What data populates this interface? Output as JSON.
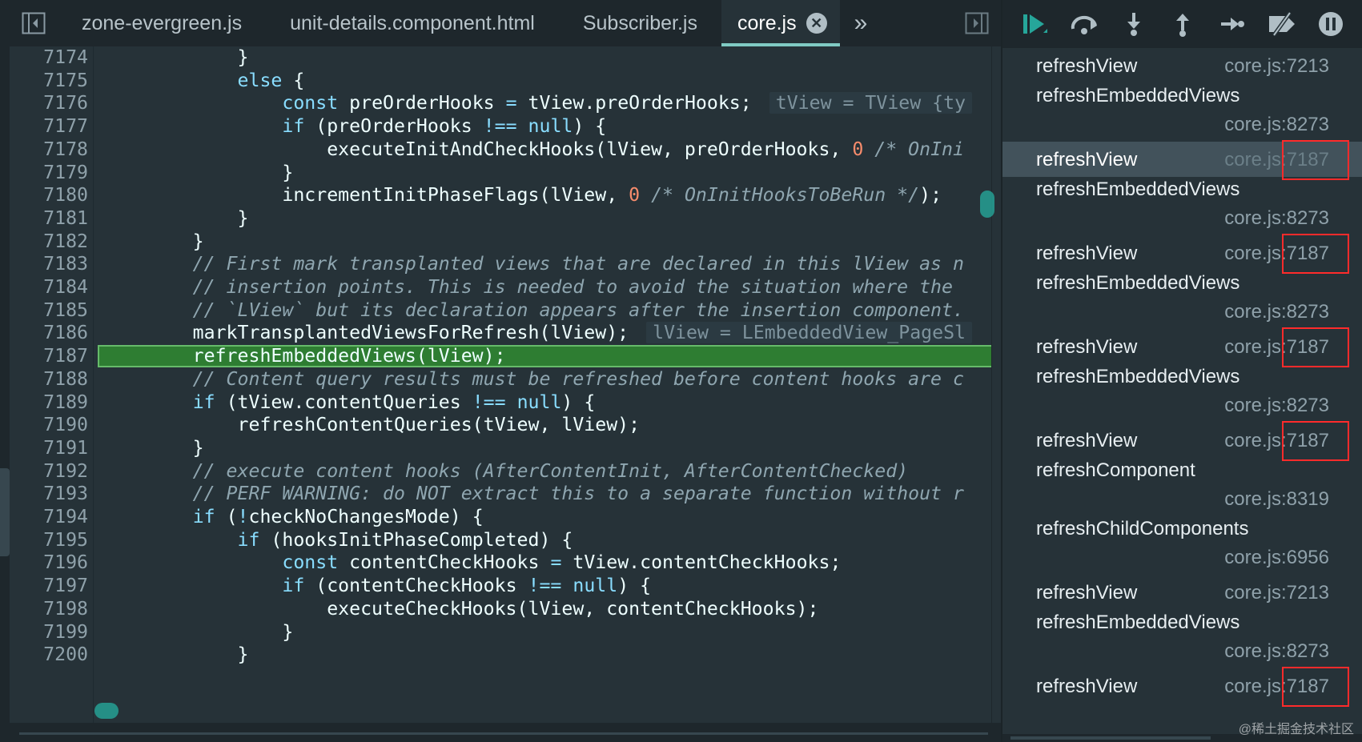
{
  "tabs": [
    {
      "label": "zone-evergreen.js"
    },
    {
      "label": "unit-details.component.html"
    },
    {
      "label": "Subscriber.js"
    },
    {
      "label": "core.js",
      "active": true
    }
  ],
  "tab_close_symbol": "✕",
  "tab_overflow_symbol": "»",
  "icons": {
    "sidebar_toggle": "sidebar-toggle-icon",
    "panel_toggle": "panel-toggle-icon",
    "resume": "resume-icon",
    "step_over": "step-over-icon",
    "step_into": "step-into-icon",
    "step_out": "step-out-icon",
    "step": "step-icon",
    "deactivate_breakpoints": "deactivate-breakpoints-icon",
    "pause_on_exceptions": "pause-icon"
  },
  "colors": {
    "keyword": "#89ddff",
    "comment": "#8fa6b0",
    "number": "#f78c6c",
    "current_line": "#2e7d32",
    "accent": "#80cbc4",
    "annotation_box": "#ff2b2b"
  },
  "code": {
    "current_line": 7187,
    "lines": [
      {
        "n": "7174",
        "t": "            }"
      },
      {
        "n": "7175",
        "t": "            else {"
      },
      {
        "n": "7176",
        "t": "                const preOrderHooks = tView.preOrderHooks;",
        "inline": "tView = TView {ty"
      },
      {
        "n": "7177",
        "t": "                if (preOrderHooks !== null) {"
      },
      {
        "n": "7178",
        "t": "                    executeInitAndCheckHooks(lView, preOrderHooks, 0 /* OnIni"
      },
      {
        "n": "7179",
        "t": "                }"
      },
      {
        "n": "7180",
        "t": "                incrementInitPhaseFlags(lView, 0 /* OnInitHooksToBeRun */);"
      },
      {
        "n": "7181",
        "t": "            }"
      },
      {
        "n": "7182",
        "t": "        }"
      },
      {
        "n": "7183",
        "t": "        // First mark transplanted views that are declared in this lView as n"
      },
      {
        "n": "7184",
        "t": "        // insertion points. This is needed to avoid the situation where the"
      },
      {
        "n": "7185",
        "t": "        // `LView` but its declaration appears after the insertion component."
      },
      {
        "n": "7186",
        "t": "        markTransplantedViewsForRefresh(lView);",
        "inline": "lView = LEmbeddedView_PageSl"
      },
      {
        "n": "7187",
        "t": "        refreshEmbeddedViews(lView);"
      },
      {
        "n": "7188",
        "t": "        // Content query results must be refreshed before content hooks are c"
      },
      {
        "n": "7189",
        "t": "        if (tView.contentQueries !== null) {"
      },
      {
        "n": "7190",
        "t": "            refreshContentQueries(tView, lView);"
      },
      {
        "n": "7191",
        "t": "        }"
      },
      {
        "n": "7192",
        "t": "        // execute content hooks (AfterContentInit, AfterContentChecked)"
      },
      {
        "n": "7193",
        "t": "        // PERF WARNING: do NOT extract this to a separate function without r"
      },
      {
        "n": "7194",
        "t": "        if (!checkNoChangesMode) {"
      },
      {
        "n": "7195",
        "t": "            if (hooksInitPhaseCompleted) {"
      },
      {
        "n": "7196",
        "t": "                const contentCheckHooks = tView.contentCheckHooks;"
      },
      {
        "n": "7197",
        "t": "                if (contentCheckHooks !== null) {"
      },
      {
        "n": "7198",
        "t": "                    executeCheckHooks(lView, contentCheckHooks);"
      },
      {
        "n": "7199",
        "t": "                }"
      },
      {
        "n": "7200",
        "t": "            }"
      }
    ]
  },
  "call_stack": [
    {
      "fn": "refreshView",
      "loc": "core.js:7213",
      "layout": "inline",
      "highlight": false
    },
    {
      "fn": "refreshEmbeddedViews",
      "loc": "core.js:8273",
      "layout": "stacked",
      "highlight": false
    },
    {
      "fn": "refreshView",
      "loc": "core.js:7187",
      "layout": "inline",
      "highlight": true,
      "selected": true
    },
    {
      "fn": "refreshEmbeddedViews",
      "loc": "core.js:8273",
      "layout": "stacked",
      "highlight": false
    },
    {
      "fn": "refreshView",
      "loc": "core.js:7187",
      "layout": "inline",
      "highlight": true
    },
    {
      "fn": "refreshEmbeddedViews",
      "loc": "core.js:8273",
      "layout": "stacked",
      "highlight": false
    },
    {
      "fn": "refreshView",
      "loc": "core.js:7187",
      "layout": "inline",
      "highlight": true
    },
    {
      "fn": "refreshEmbeddedViews",
      "loc": "core.js:8273",
      "layout": "stacked",
      "highlight": false
    },
    {
      "fn": "refreshView",
      "loc": "core.js:7187",
      "layout": "inline",
      "highlight": true
    },
    {
      "fn": "refreshComponent",
      "loc": "core.js:8319",
      "layout": "stacked",
      "highlight": false
    },
    {
      "fn": "refreshChildComponents",
      "loc": "core.js:6956",
      "layout": "stacked",
      "highlight": false
    },
    {
      "fn": "refreshView",
      "loc": "core.js:7213",
      "layout": "inline",
      "highlight": false
    },
    {
      "fn": "refreshEmbeddedViews",
      "loc": "core.js:8273",
      "layout": "stacked",
      "highlight": false
    },
    {
      "fn": "refreshView",
      "loc": "core.js:7187",
      "layout": "inline",
      "highlight": true
    }
  ],
  "watermark": "@稀土掘金技术社区"
}
